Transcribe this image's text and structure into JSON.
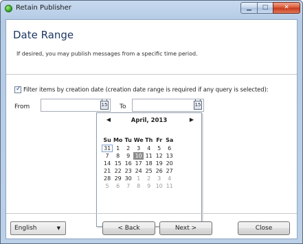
{
  "window": {
    "title": "Retain Publisher",
    "controls": {
      "minimize": "▁",
      "maximize": "□",
      "close": "✕"
    }
  },
  "header": {
    "title": "Date Range",
    "description": "If desired, you may publish messages from a specific time period."
  },
  "filter": {
    "checked": true,
    "label": "Filter items by creation date (creation date range is required if any query is selected):"
  },
  "from": {
    "label": "From",
    "value": "",
    "calendar_icon_text": "15"
  },
  "to": {
    "label": "To",
    "value": "",
    "calendar_icon_text": "15"
  },
  "calendar": {
    "month": "April, 2013",
    "prev": "◀",
    "next": "▶",
    "weekdays": [
      "Su",
      "Mo",
      "Tu",
      "We",
      "Th",
      "Fr",
      "Sa"
    ],
    "weeks": [
      [
        {
          "d": "31",
          "o": false,
          "t": true
        },
        {
          "d": "1"
        },
        {
          "d": "2"
        },
        {
          "d": "3"
        },
        {
          "d": "4"
        },
        {
          "d": "5"
        },
        {
          "d": "6"
        }
      ],
      [
        {
          "d": "7"
        },
        {
          "d": "8"
        },
        {
          "d": "9"
        },
        {
          "d": "10",
          "s": true
        },
        {
          "d": "11"
        },
        {
          "d": "12"
        },
        {
          "d": "13"
        }
      ],
      [
        {
          "d": "14"
        },
        {
          "d": "15"
        },
        {
          "d": "16"
        },
        {
          "d": "17"
        },
        {
          "d": "18"
        },
        {
          "d": "19"
        },
        {
          "d": "20"
        }
      ],
      [
        {
          "d": "21"
        },
        {
          "d": "22"
        },
        {
          "d": "23"
        },
        {
          "d": "24"
        },
        {
          "d": "25"
        },
        {
          "d": "26"
        },
        {
          "d": "27"
        }
      ],
      [
        {
          "d": "28"
        },
        {
          "d": "29"
        },
        {
          "d": "30"
        },
        {
          "d": "1",
          "o": true
        },
        {
          "d": "2",
          "o": true
        },
        {
          "d": "3",
          "o": true
        },
        {
          "d": "4",
          "o": true
        }
      ],
      [
        {
          "d": "5",
          "o": true
        },
        {
          "d": "6",
          "o": true
        },
        {
          "d": "7",
          "o": true
        },
        {
          "d": "8",
          "o": true
        },
        {
          "d": "9",
          "o": true
        },
        {
          "d": "10",
          "o": true
        },
        {
          "d": "11",
          "o": true
        }
      ]
    ]
  },
  "footer": {
    "language": "English",
    "language_arrow": "▼",
    "back": "< Back",
    "next": "Next >",
    "close": "Close"
  }
}
